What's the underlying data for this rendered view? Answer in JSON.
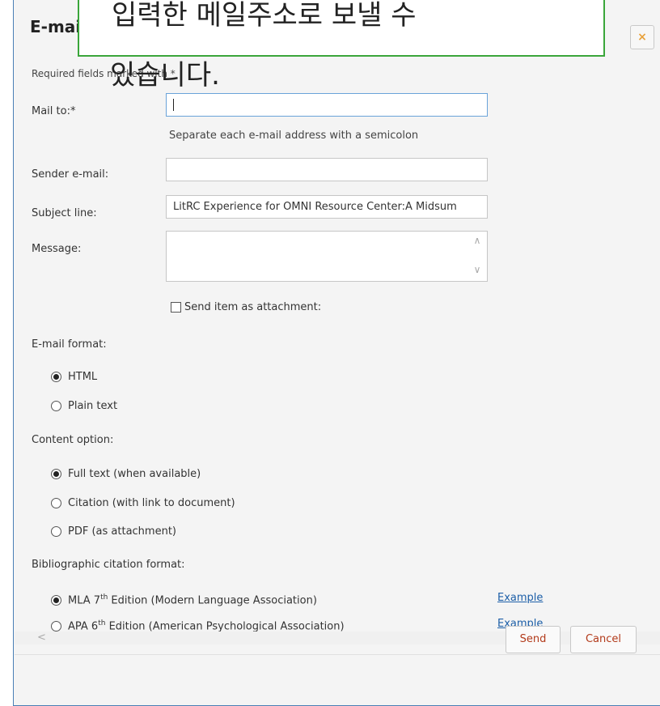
{
  "dialog": {
    "title": "E-mail",
    "close_glyph": "×"
  },
  "tooltip": {
    "line1": "입력한 메일주소로 보낼 수",
    "line2": "있습니다."
  },
  "form": {
    "required_note": "Required fields marked with *",
    "mail_to_label": "Mail to:*",
    "mail_to_value": "",
    "mail_to_hint": "Separate each e-mail address with a semicolon",
    "sender_label": "Sender e-mail:",
    "sender_value": "",
    "subject_label": "Subject line:",
    "subject_value": "LitRC Experience for OMNI Resource Center:A Midsum",
    "message_label": "Message:",
    "message_value": "",
    "attachment_label": "Send item as attachment:",
    "attachment_checked": false
  },
  "email_format": {
    "heading": "E-mail format:",
    "options": [
      {
        "label": "HTML",
        "checked": true
      },
      {
        "label": "Plain text",
        "checked": false
      }
    ]
  },
  "content_option": {
    "heading": "Content option:",
    "options": [
      {
        "label": "Full text (when available)",
        "checked": true
      },
      {
        "label": "Citation (with link to document)",
        "checked": false
      },
      {
        "label": "PDF (as attachment)",
        "checked": false
      }
    ]
  },
  "citation_format": {
    "heading": "Bibliographic citation format:",
    "options": [
      {
        "prefix": "MLA 7",
        "sup": "th",
        "suffix": " Edition (Modern Language Association)",
        "checked": true,
        "example": "Example"
      },
      {
        "prefix": "APA 6",
        "sup": "th",
        "suffix": " Edition (American Psychological Association)",
        "checked": false,
        "example": "Example"
      }
    ]
  },
  "scroll_left_glyph": "<",
  "buttons": {
    "send": "Send",
    "cancel": "Cancel"
  },
  "colors": {
    "accent_border": "#4a7fb5",
    "tooltip_border": "#3aa63a",
    "link": "#1d5fa8",
    "button_text": "#b23a1a",
    "close_icon": "#e8a13a"
  }
}
